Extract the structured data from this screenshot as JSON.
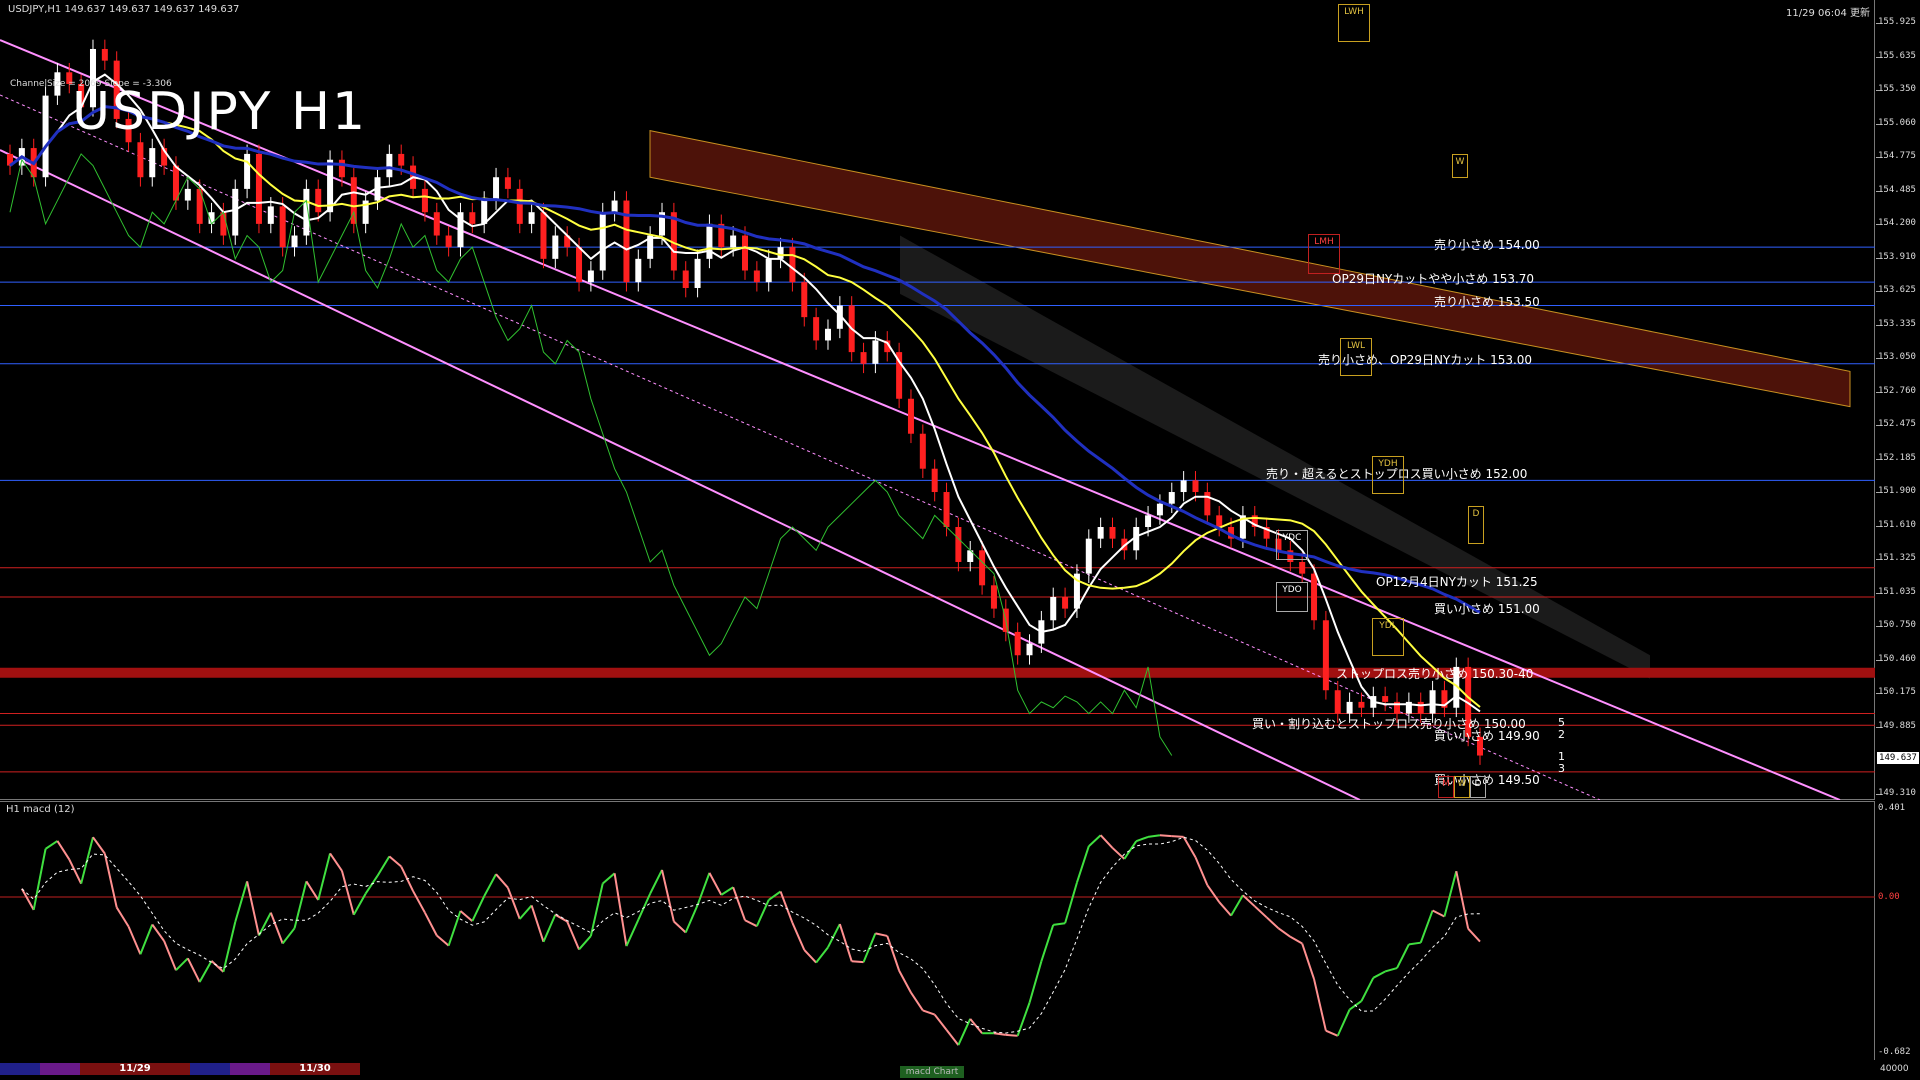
{
  "header": {
    "symbol_info": "USDJPY,H1  149.637 149.637 149.637 149.637",
    "datetime": "11/29 06:04 更新",
    "channel_info": "ChannelSize = 2069 Slope = -3.306",
    "title": "USDJPY H1"
  },
  "price_scale": {
    "labels": [
      "155.925",
      "155.635",
      "155.350",
      "155.060",
      "154.775",
      "154.485",
      "154.200",
      "153.910",
      "153.625",
      "153.335",
      "153.050",
      "152.760",
      "152.475",
      "152.185",
      "151.900",
      "151.610",
      "151.325",
      "151.035",
      "150.750",
      "150.460",
      "150.175",
      "149.885",
      "149.310"
    ],
    "current_price": "149.637"
  },
  "levels": [
    {
      "label": "売り小さめ 154.00",
      "color": "#3060ff"
    },
    {
      "label": "OP29日NYカットやや小さめ 153.70",
      "color": "#3060ff"
    },
    {
      "label": "売り小さめ 153.50",
      "color": "#3060ff"
    },
    {
      "label": "売り小さめ、OP29日NYカット 153.00",
      "color": "#3060ff"
    },
    {
      "label": "売り・超えるとストップロス買い小さめ 152.00",
      "color": "#3060ff"
    },
    {
      "label": "OP12月4日NYカット 151.25",
      "color": "#d02020"
    },
    {
      "label": "買い小さめ 151.00",
      "color": "#d02020"
    },
    {
      "label": "ストップロス売り小さめ 150.30-40",
      "color": "#a01010"
    },
    {
      "label": "買い・割り込むとストップロス売り小さめ 150.00",
      "color": "#d02020"
    },
    {
      "label": "買い小さめ 149.90",
      "color": "#d02020"
    },
    {
      "label": "買い小さめ 149.50",
      "color": "#d02020"
    }
  ],
  "markers": {
    "lwh": "LWH",
    "w": "W",
    "lmh": "LMH",
    "lwl": "LWL",
    "ydh": "YDH",
    "d": "D",
    "ydc": "YDC",
    "ydo": "YDO",
    "ydl": "YDL",
    "m": "M",
    "w2": "W",
    "d2": "D"
  },
  "pivot_numbers": [
    "5",
    "2",
    "1",
    "3"
  ],
  "macd": {
    "label": "H1  macd (12)",
    "scale": [
      "0.401",
      "0.00",
      "-0.682"
    ]
  },
  "bottom_bar": {
    "dates": [
      "11/29",
      "11/30"
    ],
    "tab": "macd Chart",
    "right_value": "40000"
  },
  "chart_data": {
    "type": "candlestick",
    "title": "USDJPY H1",
    "ylim": [
      149.31,
      156.0
    ],
    "closes": [
      154.7,
      154.85,
      154.6,
      155.3,
      155.5,
      155.4,
      155.2,
      155.7,
      155.6,
      155.1,
      154.9,
      154.6,
      154.85,
      154.7,
      154.4,
      154.5,
      154.2,
      154.3,
      154.1,
      154.5,
      154.8,
      154.2,
      154.35,
      154.0,
      154.1,
      154.5,
      154.3,
      154.75,
      154.6,
      154.2,
      154.4,
      154.6,
      154.8,
      154.7,
      154.5,
      154.3,
      154.1,
      154.0,
      154.3,
      154.2,
      154.4,
      154.6,
      154.5,
      154.2,
      154.3,
      153.9,
      154.1,
      154.0,
      153.7,
      153.8,
      154.3,
      154.4,
      153.7,
      153.9,
      154.1,
      154.3,
      153.8,
      153.65,
      153.9,
      154.2,
      154.0,
      154.1,
      153.8,
      153.7,
      153.9,
      154.0,
      153.7,
      153.4,
      153.2,
      153.3,
      153.5,
      153.1,
      153.0,
      153.2,
      153.1,
      152.7,
      152.4,
      152.1,
      151.9,
      151.6,
      151.3,
      151.4,
      151.1,
      150.9,
      150.7,
      150.5,
      150.6,
      150.8,
      151.0,
      150.9,
      151.2,
      151.5,
      151.6,
      151.5,
      151.4,
      151.6,
      151.7,
      151.8,
      151.9,
      152.0,
      151.9,
      151.7,
      151.6,
      151.5,
      151.7,
      151.6,
      151.5,
      151.4,
      151.3,
      151.2,
      150.8,
      150.2,
      150.0,
      150.1,
      150.05,
      150.15,
      150.1,
      150.0,
      150.1,
      150.0,
      150.2,
      150.05,
      150.4,
      149.8,
      149.64
    ]
  }
}
